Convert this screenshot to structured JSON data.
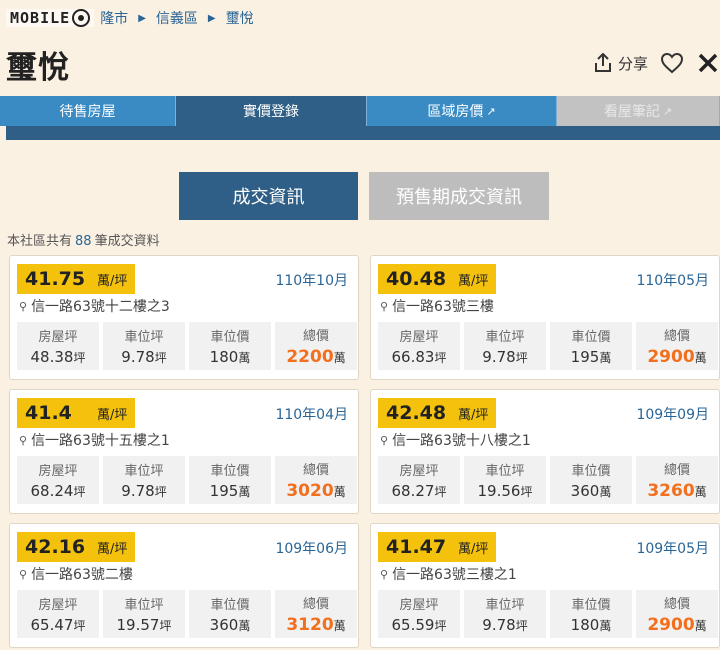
{
  "breadcrumb": {
    "logo_text": "MOBILE",
    "items": [
      "隆市",
      "信義區",
      "璽悅"
    ]
  },
  "header": {
    "title": "璽悅",
    "share_label": "分享"
  },
  "tabs": [
    {
      "label": "待售房屋"
    },
    {
      "label": "實價登錄"
    },
    {
      "label": "區域房價"
    },
    {
      "label": "看屋筆記"
    }
  ],
  "toggle": {
    "deals_label": "成交資訊",
    "presale_label": "預售期成交資訊"
  },
  "summary": {
    "prefix": "本社區共有",
    "count": "88",
    "suffix": "筆成交資料"
  },
  "labels": {
    "unit": "萬/坪",
    "area": "房屋坪",
    "parking_area": "車位坪",
    "parking_price": "車位價",
    "total": "總價",
    "ping": "坪",
    "wan": "萬"
  },
  "transactions": [
    {
      "price": "41.75",
      "date": "110年10月",
      "address": "信一路63號十二樓之3",
      "area": "48.38",
      "parking_area": "9.78",
      "parking_price": "180",
      "total": "2200"
    },
    {
      "price": "40.48",
      "date": "110年05月",
      "address": "信一路63號三樓",
      "area": "66.83",
      "parking_area": "9.78",
      "parking_price": "195",
      "total": "2900"
    },
    {
      "price": "41.4",
      "date": "110年04月",
      "address": "信一路63號十五樓之1",
      "area": "68.24",
      "parking_area": "9.78",
      "parking_price": "195",
      "total": "3020"
    },
    {
      "price": "42.48",
      "date": "109年09月",
      "address": "信一路63號十八樓之1",
      "area": "68.27",
      "parking_area": "19.56",
      "parking_price": "360",
      "total": "3260"
    },
    {
      "price": "42.16",
      "date": "109年06月",
      "address": "信一路63號二樓",
      "area": "65.47",
      "parking_area": "19.57",
      "parking_price": "360",
      "total": "3120"
    },
    {
      "price": "41.47",
      "date": "109年05月",
      "address": "信一路63號三樓之1",
      "area": "65.59",
      "parking_area": "9.78",
      "parking_price": "180",
      "total": "2900"
    }
  ],
  "colors": {
    "accent_blue": "#2f5f86",
    "tab_blue": "#3a8bc4",
    "price_yellow": "#f4c20d",
    "total_orange": "#f26f1d"
  }
}
